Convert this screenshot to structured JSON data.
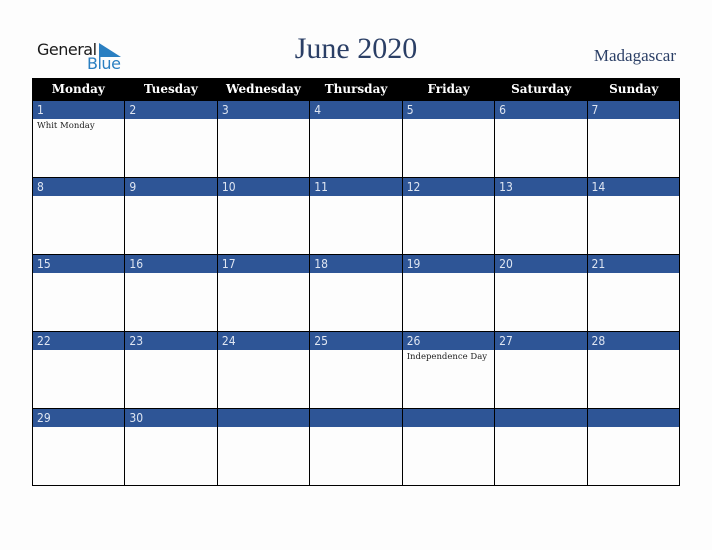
{
  "logo": {
    "general": "General",
    "blue": "Blue"
  },
  "title": "June 2020",
  "country": "Madagascar",
  "colors": {
    "header_bg": "#000000",
    "day_bar": "#2e5596",
    "title": "#2b3f66",
    "logo_blue": "#2a7fc1"
  },
  "weekdays": [
    "Monday",
    "Tuesday",
    "Wednesday",
    "Thursday",
    "Friday",
    "Saturday",
    "Sunday"
  ],
  "weeks": [
    [
      {
        "d": "1",
        "e": "Whit Monday"
      },
      {
        "d": "2",
        "e": ""
      },
      {
        "d": "3",
        "e": ""
      },
      {
        "d": "4",
        "e": ""
      },
      {
        "d": "5",
        "e": ""
      },
      {
        "d": "6",
        "e": ""
      },
      {
        "d": "7",
        "e": ""
      }
    ],
    [
      {
        "d": "8",
        "e": ""
      },
      {
        "d": "9",
        "e": ""
      },
      {
        "d": "10",
        "e": ""
      },
      {
        "d": "11",
        "e": ""
      },
      {
        "d": "12",
        "e": ""
      },
      {
        "d": "13",
        "e": ""
      },
      {
        "d": "14",
        "e": ""
      }
    ],
    [
      {
        "d": "15",
        "e": ""
      },
      {
        "d": "16",
        "e": ""
      },
      {
        "d": "17",
        "e": ""
      },
      {
        "d": "18",
        "e": ""
      },
      {
        "d": "19",
        "e": ""
      },
      {
        "d": "20",
        "e": ""
      },
      {
        "d": "21",
        "e": ""
      }
    ],
    [
      {
        "d": "22",
        "e": ""
      },
      {
        "d": "23",
        "e": ""
      },
      {
        "d": "24",
        "e": ""
      },
      {
        "d": "25",
        "e": ""
      },
      {
        "d": "26",
        "e": "Independence Day"
      },
      {
        "d": "27",
        "e": ""
      },
      {
        "d": "28",
        "e": ""
      }
    ],
    [
      {
        "d": "29",
        "e": ""
      },
      {
        "d": "30",
        "e": ""
      },
      {
        "d": "",
        "e": ""
      },
      {
        "d": "",
        "e": ""
      },
      {
        "d": "",
        "e": ""
      },
      {
        "d": "",
        "e": ""
      },
      {
        "d": "",
        "e": ""
      }
    ]
  ]
}
